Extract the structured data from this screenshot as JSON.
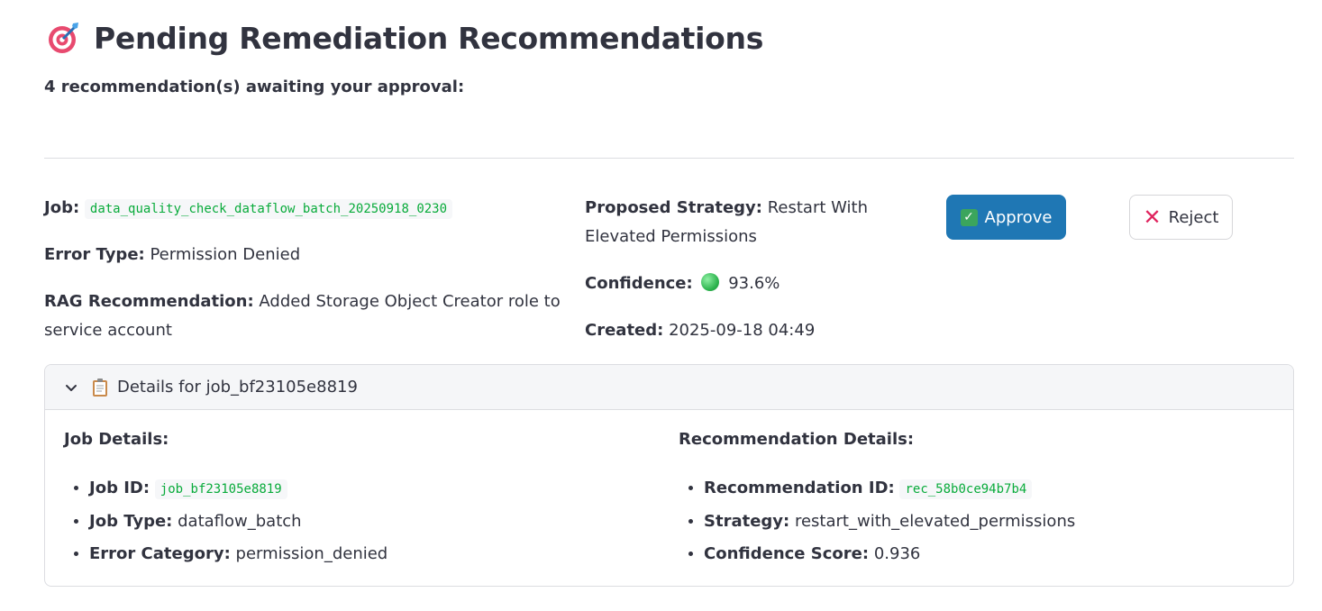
{
  "header": {
    "icon": "target-icon",
    "title": "Pending Remediation Recommendations",
    "subtitle": "4 recommendation(s) awaiting your approval:"
  },
  "recommendation": {
    "job_label": "Job:",
    "job_value": "data_quality_check_dataflow_batch_20250918_0230",
    "error_type_label": "Error Type:",
    "error_type_value": "Permission Denied",
    "rag_label": "RAG Recommendation:",
    "rag_value": "Added Storage Object Creator role to service account",
    "strategy_label": "Proposed Strategy:",
    "strategy_value": "Restart With Elevated Permissions",
    "confidence_label": "Confidence:",
    "confidence_value": "93.6%",
    "confidence_color": "#2bb24c",
    "created_label": "Created:",
    "created_value": "2025-09-18 04:49",
    "approve_label": "Approve",
    "reject_label": "Reject",
    "accent_color": "#1f77b4"
  },
  "details": {
    "header": "Details for job_bf23105e8819",
    "job_details": {
      "title": "Job Details:",
      "id_label": "Job ID:",
      "id_value": "job_bf23105e8819",
      "type_label": "Job Type:",
      "type_value": "dataflow_batch",
      "category_label": "Error Category:",
      "category_value": "permission_denied"
    },
    "rec_details": {
      "title": "Recommendation Details:",
      "id_label": "Recommendation ID:",
      "id_value": "rec_58b0ce94b7b4",
      "strategy_label": "Strategy:",
      "strategy_value": "restart_with_elevated_permissions",
      "score_label": "Confidence Score:",
      "score_value": "0.936"
    }
  }
}
